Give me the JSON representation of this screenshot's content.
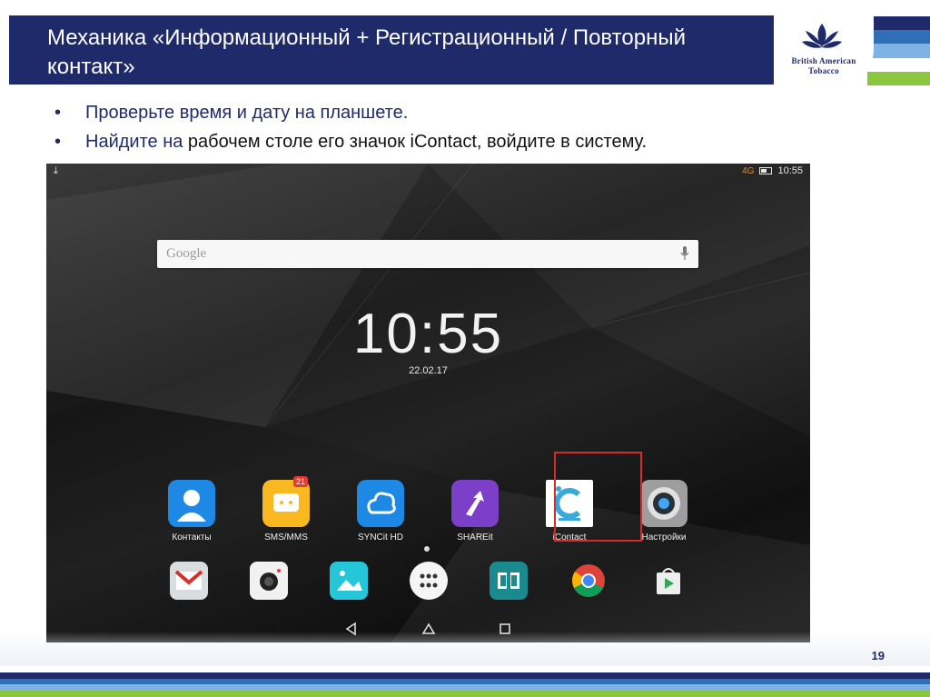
{
  "slide": {
    "title": "Механика «Информационный + Регистрационный / Повторный контакт»",
    "logo_text": [
      "British American",
      "Tobacco"
    ],
    "bullets": [
      {
        "lead": "Проверьте время и дату на планшете.",
        "rest": ""
      },
      {
        "lead": "Найдите на ",
        "rest": "рабочем столе его значок iContact, войдите в систему."
      }
    ],
    "page_number": "19",
    "colors": {
      "navy": "#1f2a6b",
      "accent_green": "#8cc63f",
      "accent_blue": "#2f6fb5",
      "highlight_red": "#d62b2b"
    }
  },
  "tablet": {
    "status": {
      "left_icon": "download-icon",
      "network": "4G",
      "time": "10:55"
    },
    "search": {
      "placeholder": "Google",
      "icon": "mic-icon"
    },
    "clock": {
      "time": "10:55",
      "date": "22.02.17"
    },
    "apps": [
      {
        "label": "Контакты",
        "icon": "contacts-icon",
        "color": "#1e88e5"
      },
      {
        "label": "SMS/MMS",
        "icon": "sms-icon",
        "color": "#f9b820",
        "badge": "21"
      },
      {
        "label": "SYNCit HD",
        "icon": "cloud-sync-icon",
        "color": "#1e88e5"
      },
      {
        "label": "SHAREit",
        "icon": "shareit-icon",
        "color": "#7b3fc8"
      },
      {
        "label": "iContact",
        "icon": "icontact-icon",
        "color": "#ffffff"
      },
      {
        "label": "Настройки",
        "icon": "settings-icon",
        "color": "#9e9e9e"
      }
    ],
    "dock": [
      {
        "icon": "gmail-icon"
      },
      {
        "icon": "camera-icon"
      },
      {
        "icon": "gallery-icon"
      },
      {
        "icon": "app-drawer-icon"
      },
      {
        "icon": "dolby-icon"
      },
      {
        "icon": "chrome-icon"
      },
      {
        "icon": "play-store-icon"
      }
    ],
    "nav": [
      "back-icon",
      "home-icon",
      "recents-icon"
    ]
  }
}
